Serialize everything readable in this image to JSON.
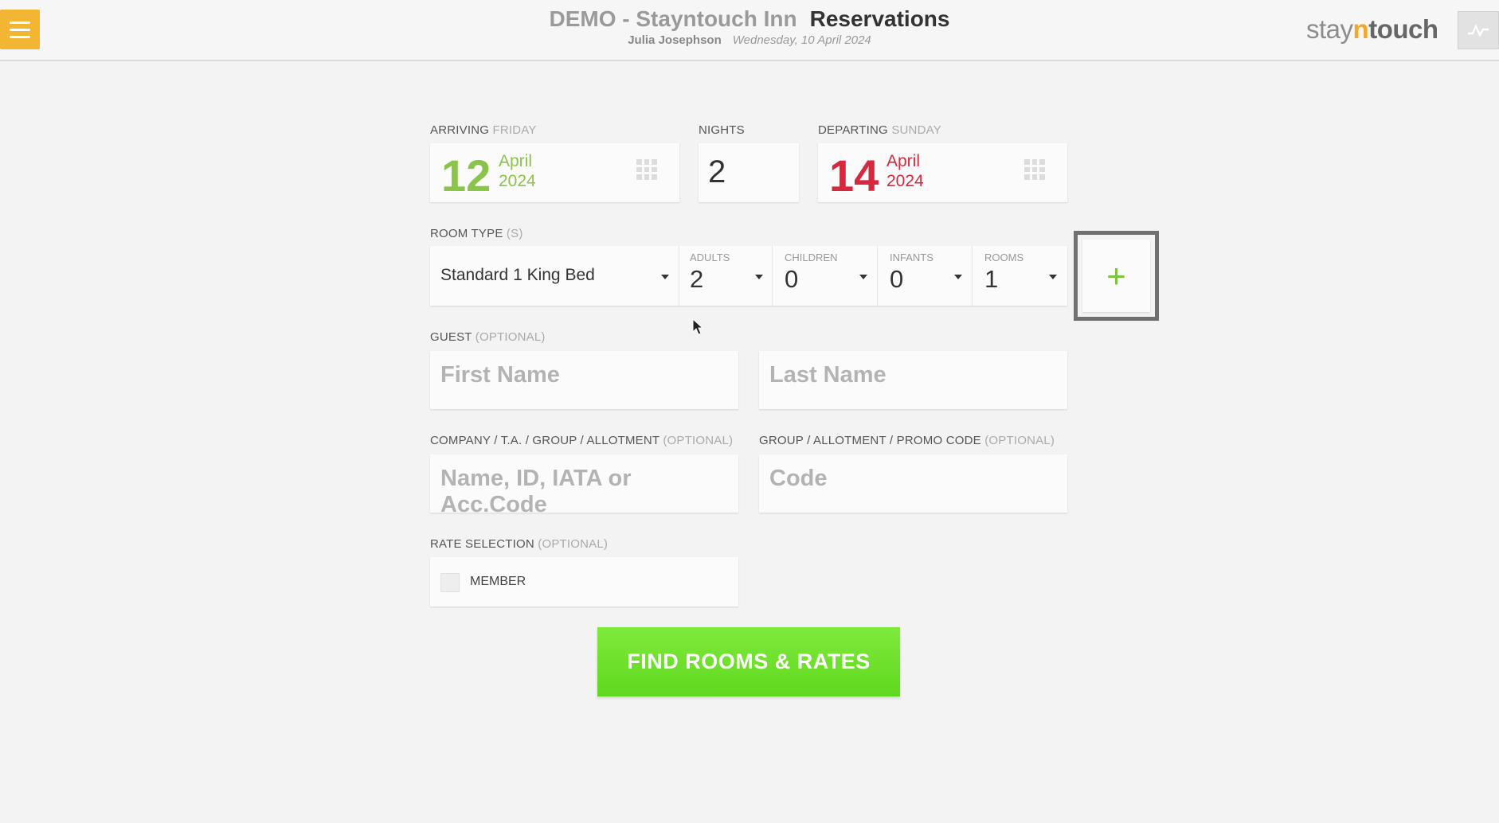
{
  "header": {
    "hotel_name": "DEMO - Stayntouch Inn",
    "page_title": "Reservations",
    "user_name": "Julia Josephson",
    "business_date": "Wednesday, 10 April 2024",
    "brand_prefix": "stay",
    "brand_n": "n",
    "brand_suffix": "touch"
  },
  "arrival": {
    "label": "ARRIVING",
    "weekday": "FRIDAY",
    "day": "12",
    "month": "April",
    "year": "2024"
  },
  "nights": {
    "label": "NIGHTS",
    "value": "2"
  },
  "departure": {
    "label": "DEPARTING",
    "weekday": "SUNDAY",
    "day": "14",
    "month": "April",
    "year": "2024"
  },
  "room": {
    "label": "ROOM TYPE",
    "label_suffix": "(S)",
    "room_type": "Standard 1 King Bed",
    "adults_label": "ADULTS",
    "adults": "2",
    "children_label": "CHILDREN",
    "children": "0",
    "infants_label": "INFANTS",
    "infants": "0",
    "rooms_label": "ROOMS",
    "rooms": "1",
    "add_label": "+"
  },
  "guest": {
    "label": "GUEST",
    "optional": "(OPTIONAL)",
    "first_placeholder": "First Name",
    "last_placeholder": "Last Name"
  },
  "company": {
    "label": "COMPANY / T.A. / GROUP / ALLOTMENT",
    "optional": "(OPTIONAL)",
    "placeholder": "Name, ID, IATA or Acc.Code"
  },
  "promo": {
    "label": "GROUP / ALLOTMENT / PROMO CODE",
    "optional": "(OPTIONAL)",
    "placeholder": "Code"
  },
  "rate": {
    "label": "RATE SELECTION",
    "optional": "(OPTIONAL)",
    "member_label": "MEMBER"
  },
  "find_button": "FIND ROOMS & RATES",
  "colors": {
    "accent_green": "#5fd81e",
    "arrival_green": "#8ac44a",
    "departure_red": "#d6283f",
    "menu_orange": "#f2b633"
  }
}
